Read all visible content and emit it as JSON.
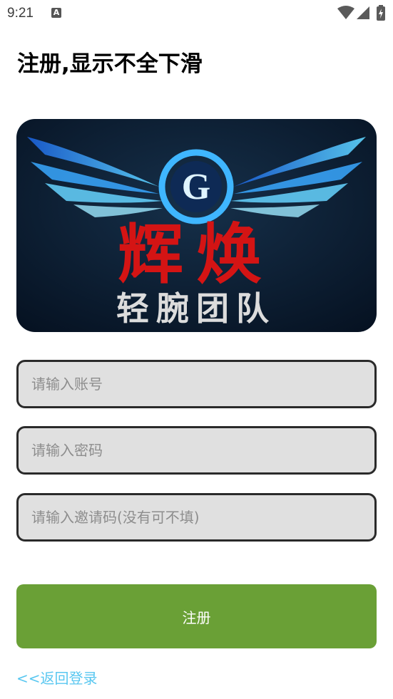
{
  "status_bar": {
    "time": "9:21",
    "notification_icon": "A"
  },
  "title": "注册,显示不全下滑",
  "logo": {
    "icon": "winged-g-team-logo",
    "brand_text": "辉焕",
    "team_text": "轻腕团队"
  },
  "form": {
    "account_placeholder": "请输入账号",
    "password_placeholder": "请输入密码",
    "invite_placeholder": "请输入邀请码(没有可不填)",
    "submit_label": "注册"
  },
  "back_link": "<<返回登录",
  "colors": {
    "submit_bg": "#6aa036",
    "link": "#59c7f0",
    "input_bg": "#e0e0e0"
  }
}
